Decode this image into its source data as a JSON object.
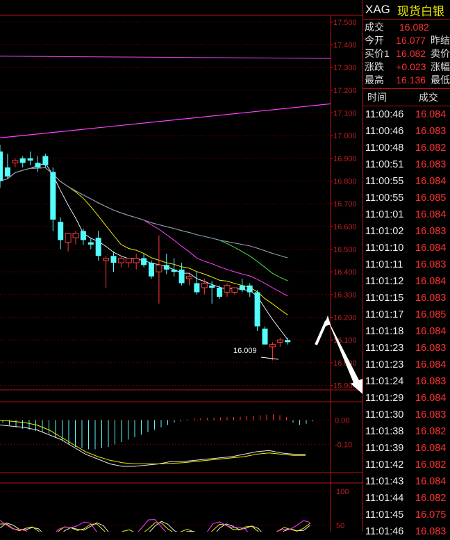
{
  "symbol": "XAG",
  "name": "现货白银",
  "quote": [
    {
      "label": "成交",
      "value": "16.082",
      "extra": ""
    },
    {
      "label": "今开",
      "value": "16.077",
      "extra": "昨结"
    },
    {
      "label": "买价1",
      "value": "16.082",
      "extra": "卖价"
    },
    {
      "label": "涨跌",
      "value": "+0.023",
      "extra": "涨幅"
    },
    {
      "label": "最高",
      "value": "16.136",
      "extra": "最低"
    }
  ],
  "ticks_header": {
    "time": "时间",
    "price": "成交"
  },
  "ticks": [
    {
      "time": "11:00:46",
      "price": "16.084"
    },
    {
      "time": "11:00:46",
      "price": "16.083"
    },
    {
      "time": "11:00:48",
      "price": "16.082"
    },
    {
      "time": "11:00:51",
      "price": "16.083"
    },
    {
      "time": "11:00:55",
      "price": "16.084"
    },
    {
      "time": "11:00:55",
      "price": "16.085"
    },
    {
      "time": "11:01:01",
      "price": "16.084"
    },
    {
      "time": "11:01:02",
      "price": "16.083"
    },
    {
      "time": "11:01:10",
      "price": "16.084"
    },
    {
      "time": "11:01:11",
      "price": "16.083"
    },
    {
      "time": "11:01:12",
      "price": "16.084"
    },
    {
      "time": "11:01:15",
      "price": "16.083"
    },
    {
      "time": "11:01:17",
      "price": "16.085"
    },
    {
      "time": "11:01:18",
      "price": "16.084"
    },
    {
      "time": "11:01:23",
      "price": "16.083"
    },
    {
      "time": "11:01:23",
      "price": "16.084"
    },
    {
      "time": "11:01:24",
      "price": "16.083"
    },
    {
      "time": "11:01:29",
      "price": "16.084"
    },
    {
      "time": "11:01:30",
      "price": "16.083"
    },
    {
      "time": "11:01:38",
      "price": "16.082"
    },
    {
      "time": "11:01:39",
      "price": "16.084"
    },
    {
      "time": "11:01:42",
      "price": "16.082"
    },
    {
      "time": "11:01:43",
      "price": "16.084"
    },
    {
      "time": "11:01:44",
      "price": "16.082"
    },
    {
      "time": "11:01:45",
      "price": "16.075"
    },
    {
      "time": "11:01:46",
      "price": "16.083"
    }
  ],
  "chart_data": {
    "type": "candlestick",
    "price_axis": [
      "17.500",
      "17.400",
      "17.300",
      "17.200",
      "17.100",
      "17.000",
      "16.900",
      "16.800",
      "16.700",
      "16.600",
      "16.500",
      "16.400",
      "16.300",
      "16.200",
      "16.100",
      "16.000",
      "15.900"
    ],
    "ylim": [
      15.88,
      17.53
    ],
    "low_annotation": "16.009",
    "candles": [
      [
        16.93,
        16.96,
        16.77,
        16.8
      ],
      [
        16.86,
        16.92,
        16.81,
        16.82
      ],
      [
        16.88,
        16.9,
        16.86,
        16.89
      ],
      [
        16.9,
        16.91,
        16.86,
        16.88
      ],
      [
        16.9,
        16.93,
        16.87,
        16.89
      ],
      [
        16.88,
        16.91,
        16.84,
        16.86
      ],
      [
        16.91,
        16.92,
        16.86,
        16.87
      ],
      [
        16.84,
        16.86,
        16.58,
        16.63
      ],
      [
        16.62,
        16.64,
        16.5,
        16.54
      ],
      [
        16.53,
        16.55,
        16.49,
        16.57
      ],
      [
        16.55,
        16.58,
        16.52,
        16.57
      ],
      [
        16.58,
        16.59,
        16.52,
        16.54
      ],
      [
        16.53,
        16.55,
        16.5,
        16.52
      ],
      [
        16.55,
        16.58,
        16.45,
        16.47
      ],
      [
        16.45,
        16.47,
        16.33,
        16.46
      ],
      [
        16.47,
        16.49,
        16.4,
        16.44
      ],
      [
        16.44,
        16.47,
        16.42,
        16.46
      ],
      [
        16.44,
        16.46,
        16.42,
        16.46
      ],
      [
        16.44,
        16.48,
        16.41,
        16.46
      ],
      [
        16.46,
        16.48,
        16.42,
        16.43
      ],
      [
        16.44,
        16.45,
        16.37,
        16.38
      ],
      [
        16.4,
        16.56,
        16.26,
        16.43
      ],
      [
        16.43,
        16.48,
        16.39,
        16.41
      ],
      [
        16.41,
        16.46,
        16.38,
        16.4
      ],
      [
        16.41,
        16.44,
        16.34,
        16.35
      ],
      [
        16.37,
        16.39,
        16.34,
        16.38
      ],
      [
        16.35,
        16.4,
        16.3,
        16.31
      ],
      [
        16.33,
        16.37,
        16.3,
        16.35
      ],
      [
        16.34,
        16.36,
        16.26,
        16.33
      ],
      [
        16.33,
        16.34,
        16.28,
        16.29
      ],
      [
        16.31,
        16.35,
        16.29,
        16.34
      ],
      [
        16.31,
        16.33,
        16.3,
        16.33
      ],
      [
        16.34,
        16.37,
        16.31,
        16.32
      ],
      [
        16.34,
        16.35,
        16.29,
        16.31
      ],
      [
        16.31,
        16.32,
        16.14,
        16.16
      ],
      [
        16.15,
        16.16,
        16.08,
        16.08
      ],
      [
        16.07,
        16.09,
        16.01,
        16.08
      ],
      [
        16.09,
        16.11,
        16.07,
        16.1
      ],
      [
        16.1,
        16.11,
        16.08,
        16.09
      ]
    ],
    "macd": {
      "axis": [
        "0.00",
        "-0.10"
      ],
      "ylim": [
        -0.21,
        0.07
      ],
      "hist": [
        -0.01,
        -0.02,
        -0.03,
        -0.035,
        -0.04,
        -0.045,
        -0.05,
        -0.055,
        -0.07,
        -0.085,
        -0.1,
        -0.11,
        -0.115,
        -0.12,
        -0.12,
        -0.115,
        -0.11,
        -0.1,
        -0.09,
        -0.08,
        -0.07,
        -0.06,
        -0.05,
        -0.04,
        -0.03,
        -0.02,
        -0.01,
        -0.005,
        0.004,
        0.007,
        0.008,
        0.009,
        0.01,
        0.011,
        0.012,
        0.013,
        0.014,
        0.016,
        0.018,
        0.02,
        0.022,
        0.024,
        0.02,
        0.012,
        -0.01,
        -0.02,
        -0.015,
        -0.005
      ],
      "line1": [
        -0.02,
        -0.025,
        -0.03,
        -0.04,
        -0.06,
        -0.08,
        -0.11,
        -0.14,
        -0.16,
        -0.18,
        -0.19,
        -0.19,
        -0.185,
        -0.18,
        -0.17,
        -0.17,
        -0.165,
        -0.16,
        -0.155,
        -0.15,
        -0.14,
        -0.13,
        -0.125,
        -0.135,
        -0.14,
        -0.14
      ],
      "line2": [
        0.0,
        -0.005,
        -0.01,
        -0.02,
        -0.04,
        -0.07,
        -0.1,
        -0.13,
        -0.15,
        -0.165,
        -0.175,
        -0.18,
        -0.18,
        -0.18,
        -0.178,
        -0.175,
        -0.17,
        -0.165,
        -0.16,
        -0.155,
        -0.15,
        -0.14,
        -0.135,
        -0.14,
        -0.145,
        -0.145
      ]
    },
    "kdj": {
      "axis": [
        "100",
        "50"
      ],
      "ylim": [
        0,
        110
      ]
    }
  }
}
